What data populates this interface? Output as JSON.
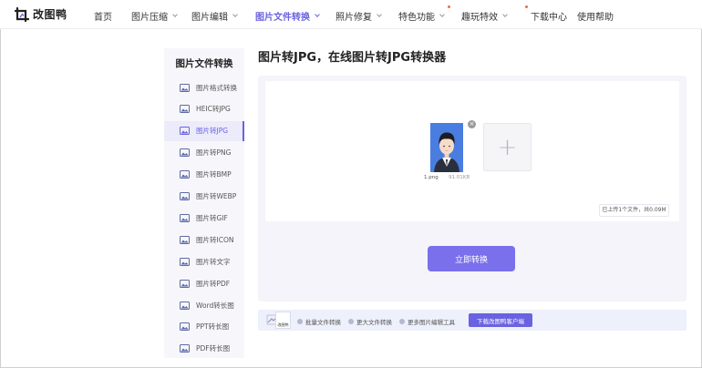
{
  "header": {
    "logo_text": "改图鸭",
    "nav": [
      {
        "label": "首页"
      },
      {
        "label": "图片压缩"
      },
      {
        "label": "图片编辑"
      },
      {
        "label": "图片文件转换"
      },
      {
        "label": "照片修复"
      },
      {
        "label": "特色功能"
      },
      {
        "label": "趣玩特效"
      },
      {
        "label": "下载中心"
      },
      {
        "label": "使用帮助"
      }
    ],
    "accent_color": "#6a62e0",
    "dot_color": "#f26a3c"
  },
  "sidebar": {
    "title": "图片文件转换",
    "items": [
      {
        "label": "图片格式转换"
      },
      {
        "label": "HEIC转JPG"
      },
      {
        "label": "图片转JPG"
      },
      {
        "label": "图片转PNG"
      },
      {
        "label": "图片转BMP"
      },
      {
        "label": "图片转WEBP"
      },
      {
        "label": "图片转GIF"
      },
      {
        "label": "图片转ICON"
      },
      {
        "label": "图片转文字"
      },
      {
        "label": "图片转PDF"
      },
      {
        "label": "Word转长图"
      },
      {
        "label": "PPT转长图"
      },
      {
        "label": "PDF转长图"
      }
    ],
    "active_index": 2
  },
  "main": {
    "title": "图片转JPG，在线图片转JPG转换器",
    "file": {
      "name": "1.png",
      "size": "91.01KB",
      "remove_glyph": "×"
    },
    "add_glyph": "+",
    "upload_status": "已上传1个文件，共0.09M",
    "convert_button": "立即转换"
  },
  "promo": {
    "card_label": "改图鸭",
    "features": [
      "批量文件转换",
      "更大文件转换",
      "更多图片编辑工具"
    ],
    "download_button": "下载改图鸭客户端"
  }
}
